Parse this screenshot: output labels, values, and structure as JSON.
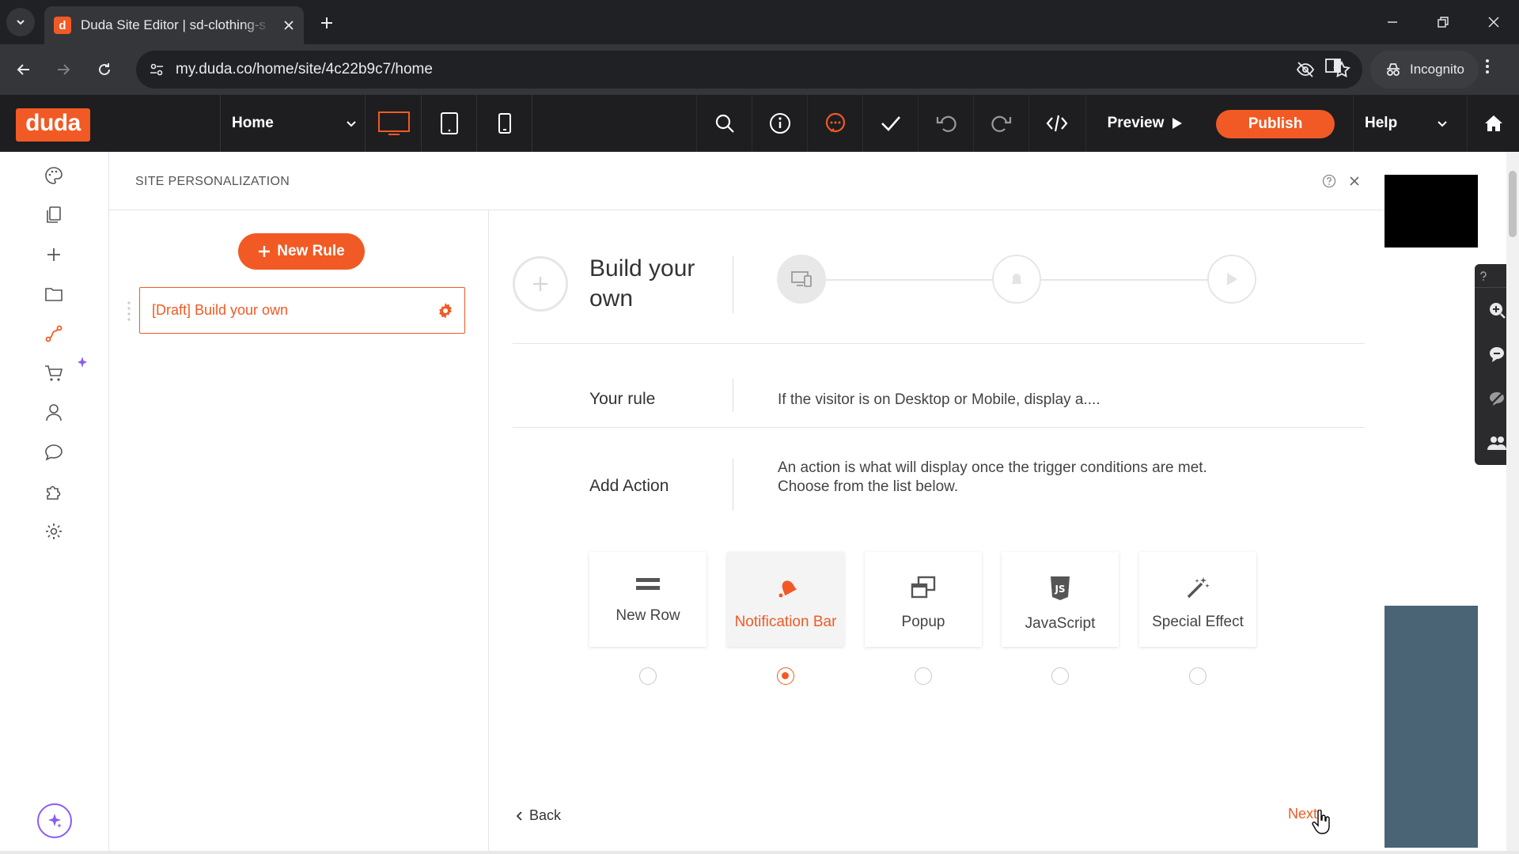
{
  "browser": {
    "tab_title": "Duda Site Editor | sd-clothing-s",
    "favicon_letter": "d",
    "url": "my.duda.co/home/site/4c22b9c7/home",
    "incognito_label": "Incognito"
  },
  "toolbar": {
    "logo": "duda",
    "page_selected": "Home",
    "preview_label": "Preview",
    "publish_label": "Publish",
    "help_label": "Help"
  },
  "panel": {
    "title": "SITE PERSONALIZATION",
    "new_rule_label": "New Rule",
    "rules": [
      {
        "label": "[Draft] Build your own"
      }
    ],
    "build_title": "Build your own",
    "your_rule_label": "Your rule",
    "your_rule_text": "If the visitor is on Desktop or Mobile, display a....",
    "add_action_label": "Add Action",
    "add_action_desc_line1": "An action is what will display once the trigger conditions are met.",
    "add_action_desc_line2": "Choose from the list below.",
    "actions": [
      {
        "label": "New Row",
        "icon": "rows-icon",
        "selected": false
      },
      {
        "label": "Notification Bar",
        "icon": "bell-icon",
        "selected": true
      },
      {
        "label": "Popup",
        "icon": "popup-icon",
        "selected": false
      },
      {
        "label": "JavaScript",
        "icon": "js-icon",
        "selected": false
      },
      {
        "label": "Special Effect",
        "icon": "magic-wand-icon",
        "selected": false
      }
    ],
    "back_label": "Back",
    "next_label": "Next"
  },
  "colors": {
    "brand": "#f15a24",
    "toolbar_bg": "#1e1e21",
    "browser_bg": "#202124"
  }
}
